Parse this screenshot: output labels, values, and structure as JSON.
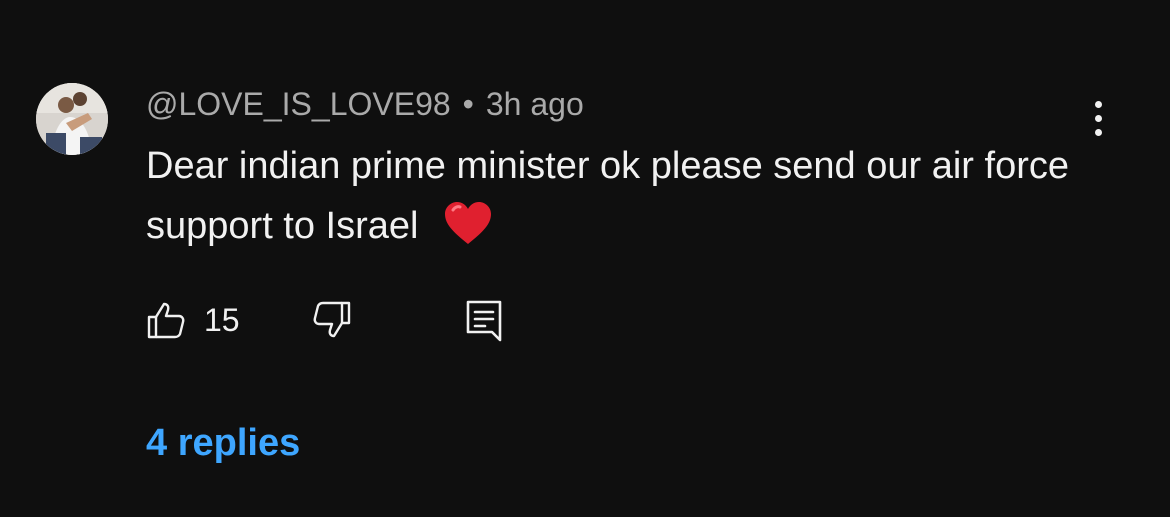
{
  "comment": {
    "author": "@LOVE_IS_LOVE98",
    "separator": "•",
    "time": "3h ago",
    "text": "Dear indian prime minister ok please send our air force support to Israel",
    "emoji": "❤️",
    "like_count": "15",
    "replies_label": "4 replies"
  },
  "icons": {
    "avatar": "user-avatar",
    "more": "more-vert-icon",
    "like": "thumbs-up-icon",
    "dislike": "thumbs-down-icon",
    "reply": "comment-reply-icon"
  },
  "colors": {
    "background": "#0f0f0f",
    "text": "#f1f1f1",
    "meta": "#aaaaaa",
    "link": "#3ea6ff",
    "heart": "#e0202f"
  }
}
